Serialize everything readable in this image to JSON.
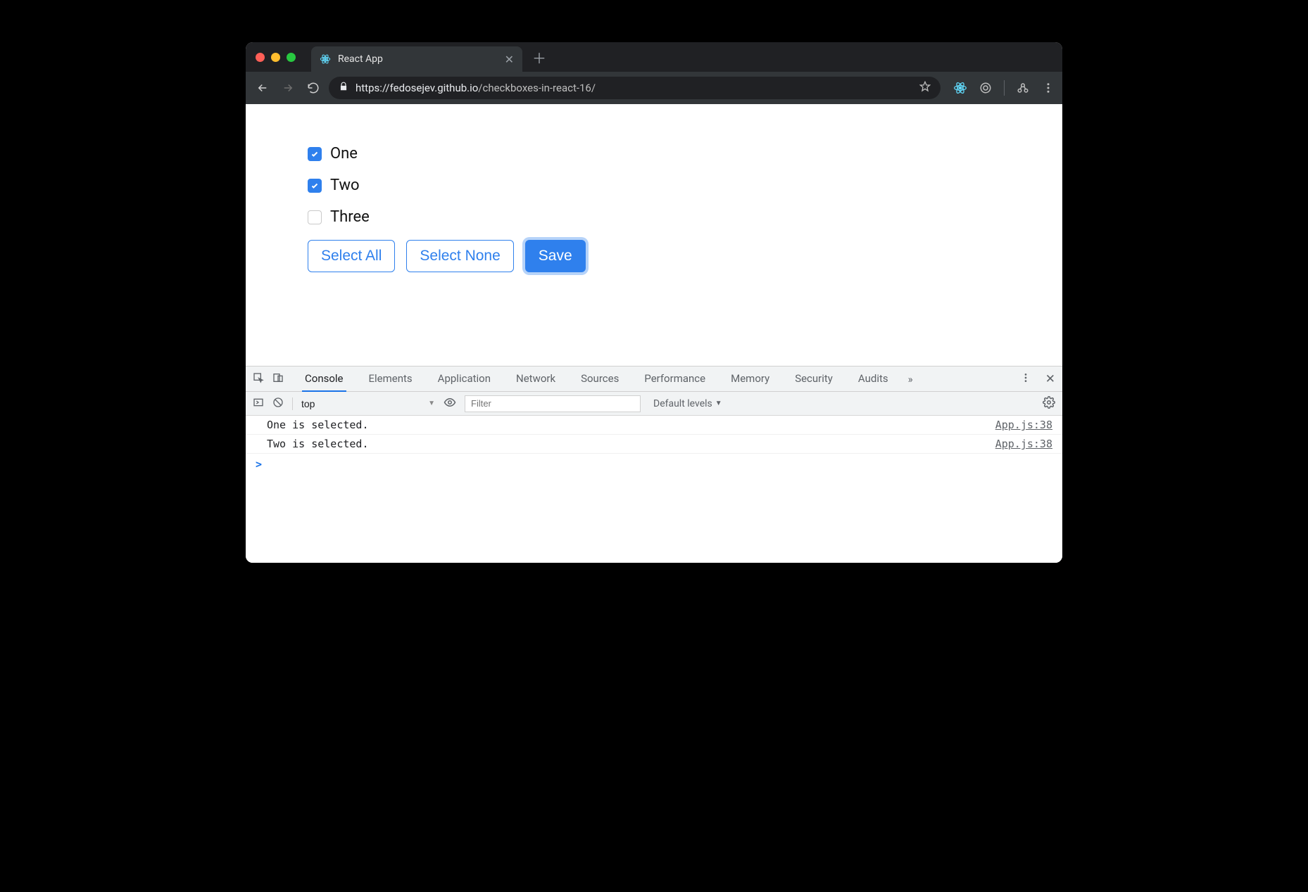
{
  "browser": {
    "tab_title": "React App",
    "url_full": "https://fedosejev.github.io/checkboxes-in-react-16/",
    "url_host": "https://fedosejev.github.io",
    "url_path": "/checkboxes-in-react-16/"
  },
  "page": {
    "checkboxes": [
      {
        "label": "One",
        "checked": true
      },
      {
        "label": "Two",
        "checked": true
      },
      {
        "label": "Three",
        "checked": false
      }
    ],
    "buttons": {
      "select_all": "Select All",
      "select_none": "Select None",
      "save": "Save"
    }
  },
  "devtools": {
    "tabs": [
      "Console",
      "Elements",
      "Application",
      "Network",
      "Sources",
      "Performance",
      "Memory",
      "Security",
      "Audits"
    ],
    "active_tab": "Console",
    "more_tabs_icon": "»",
    "context": "top",
    "filter_placeholder": "Filter",
    "levels_label": "Default levels",
    "logs": [
      {
        "msg": "One is selected.",
        "src": "App.js:38"
      },
      {
        "msg": "Two is selected.",
        "src": "App.js:38"
      }
    ],
    "prompt": ">"
  }
}
